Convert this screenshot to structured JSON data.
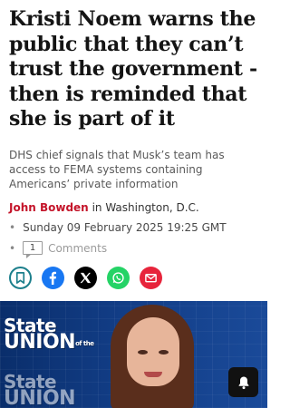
{
  "article": {
    "headline": "Kristi Noem warns the public that they can’t trust the government - then is reminded that she is part of it",
    "standfirst": "DHS chief signals that Musk’s team has access to FEMA systems containing Americans’ private information",
    "author": "John Bowden",
    "location": "in Washington, D.C.",
    "date": "Sunday 09 February 2025 19:25 GMT",
    "comment_count": "1",
    "comments_label": "Comments"
  },
  "share": [
    {
      "icon": "bookmark-icon",
      "color": "#1c7f8c"
    },
    {
      "icon": "facebook-icon",
      "color": "#1877f2"
    },
    {
      "icon": "x-icon",
      "color": "#000000"
    },
    {
      "icon": "whatsapp-icon",
      "color": "#25d366"
    },
    {
      "icon": "email-icon",
      "color": "#e7243b"
    }
  ],
  "hero": {
    "logo_line1": "State",
    "logo_line2": "of the",
    "logo_line3": "UNION"
  },
  "colors": {
    "author": "#c4142a",
    "hero_bg": "#123d86"
  }
}
